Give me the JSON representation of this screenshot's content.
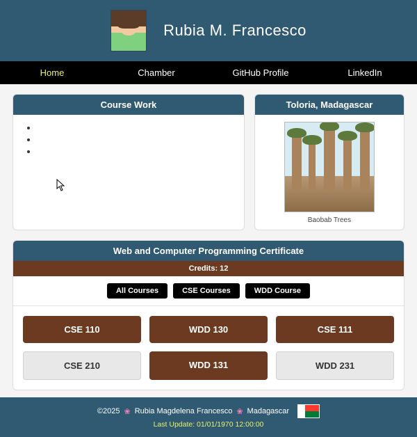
{
  "header": {
    "name": "Rubia M. Francesco"
  },
  "nav": {
    "items": [
      {
        "label": "Home",
        "active": true
      },
      {
        "label": "Chamber",
        "active": false
      },
      {
        "label": "GitHub Profile",
        "active": false
      },
      {
        "label": "LinkedIn",
        "active": false
      }
    ]
  },
  "course_work": {
    "title": "Course Work",
    "items": [
      "",
      "",
      ""
    ]
  },
  "location": {
    "title": "Toloria, Madagascar",
    "caption": "Baobab Trees"
  },
  "certificate": {
    "title": "Web and Computer Programming Certificate",
    "credits_label": "Credits: 12",
    "filters": [
      {
        "label": "All Courses"
      },
      {
        "label": "CSE Courses"
      },
      {
        "label": "WDD Course"
      }
    ],
    "courses": [
      {
        "code": "CSE 110",
        "completed": true
      },
      {
        "code": "WDD 130",
        "completed": true
      },
      {
        "code": "CSE 111",
        "completed": true
      },
      {
        "code": "CSE 210",
        "completed": false
      },
      {
        "code": "WDD 131",
        "completed": true
      },
      {
        "code": "WDD 231",
        "completed": false
      }
    ]
  },
  "footer": {
    "copyright": "©2025",
    "full_name": "Rubia Magdelena Francesco",
    "country": "Madagascar",
    "last_update": "Last Update: 01/01/1970 12:00:00"
  }
}
